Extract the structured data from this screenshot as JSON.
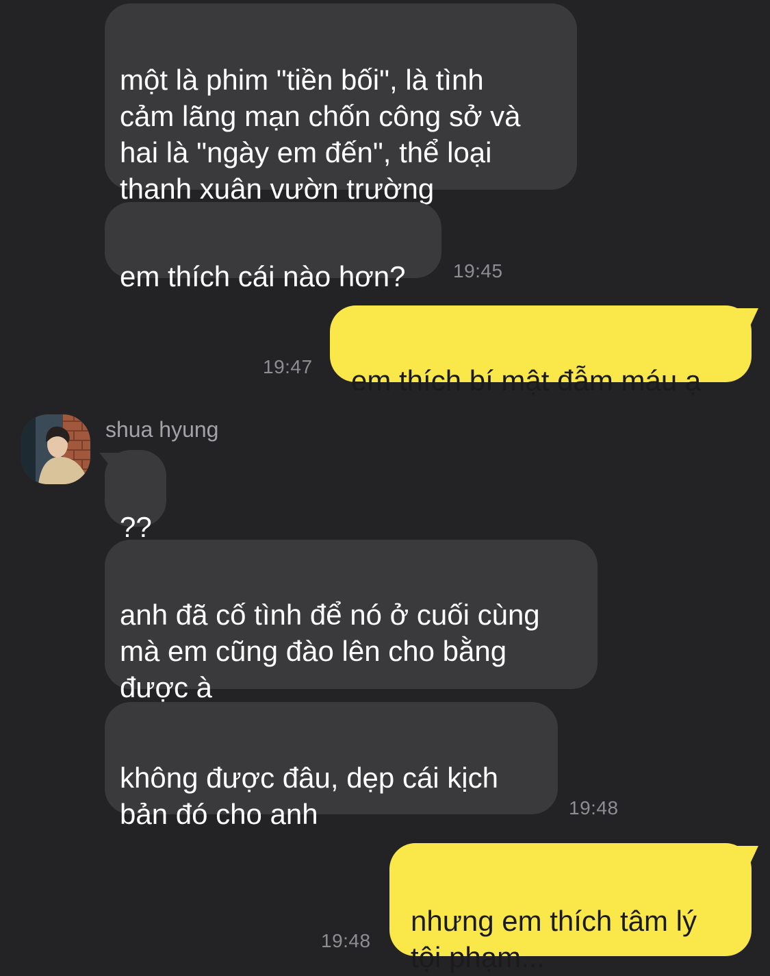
{
  "messages": {
    "m1": {
      "text": "một là phim \"tiền bối\", là tình\ncảm lãng mạn chốn công sở và\nhai là \"ngày em đến\", thể loại\nthanh xuân vườn trường"
    },
    "m2": {
      "text": "em thích cái nào hơn?",
      "time": "19:45"
    },
    "m3": {
      "text": "em thích bí mật đẫm máu ạ",
      "time": "19:47"
    },
    "m4": {
      "text": "??"
    },
    "m5": {
      "text": "anh đã cố tình để nó ở cuối cùng\nmà em cũng đào lên cho bằng\nđược à"
    },
    "m6": {
      "text": "không được đâu, dẹp cái kịch\nbản đó cho anh",
      "time": "19:48"
    },
    "m7": {
      "text": "nhưng em thích tâm lý\ntội phạm...",
      "time": "19:48"
    }
  },
  "contact": {
    "name": "shua hyung"
  },
  "colors": {
    "background": "#232325",
    "incoming_bubble": "#3a3a3c",
    "outgoing_bubble": "#fae84a",
    "timestamp": "#8e8e92"
  }
}
